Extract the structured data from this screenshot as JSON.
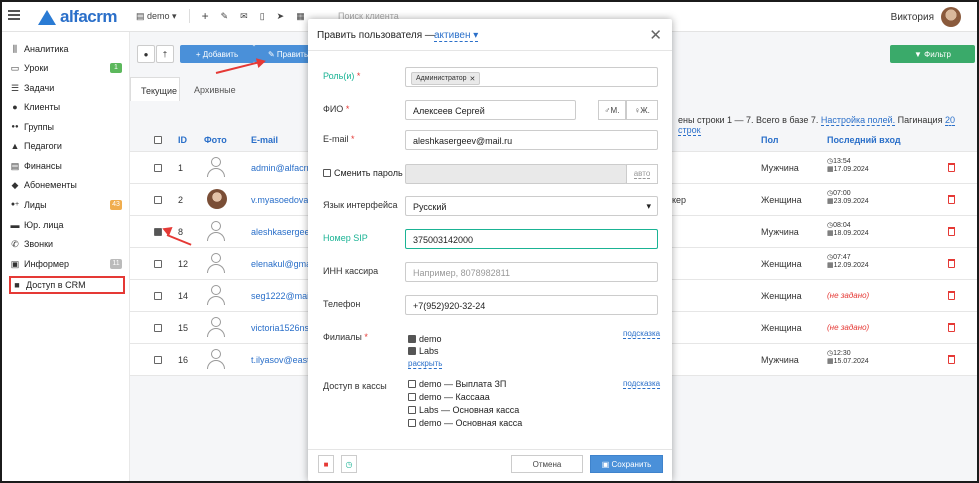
{
  "app": {
    "logo_text": "alfacrm",
    "user_name": "Виктория",
    "search_placeholder": "Поиск клиента"
  },
  "topbar": {
    "branch": "demo",
    "branch_caret": "▾",
    "plus_label": "+",
    "icons": [
      "wrench-icon",
      "mail-icon",
      "phone-icon",
      "telegram-icon",
      "calendar-icon"
    ]
  },
  "sidebar": {
    "items": [
      {
        "label": "Аналитика",
        "icon": "chart-icon",
        "glyph": "⫼"
      },
      {
        "label": "Уроки",
        "icon": "calendar-icon",
        "glyph": "▭",
        "badge": "1",
        "badge_color": "#5cb85c"
      },
      {
        "label": "Задачи",
        "icon": "tasks-icon",
        "glyph": "☰"
      },
      {
        "label": "Клиенты",
        "icon": "user-icon",
        "glyph": "●"
      },
      {
        "label": "Группы",
        "icon": "users-icon",
        "glyph": "●●"
      },
      {
        "label": "Педагоги",
        "icon": "graduation-icon",
        "glyph": "▲"
      },
      {
        "label": "Финансы",
        "icon": "money-icon",
        "glyph": "▤"
      },
      {
        "label": "Абонементы",
        "icon": "tag-icon",
        "glyph": "◆"
      },
      {
        "label": "Лиды",
        "icon": "leads-icon",
        "glyph": "●+",
        "badge": "43",
        "badge_color": "#f0ad4e"
      },
      {
        "label": "Юр. лица",
        "icon": "briefcase-icon",
        "glyph": "▬"
      },
      {
        "label": "Звонки",
        "icon": "phone-icon",
        "glyph": "✆"
      },
      {
        "label": "Информер",
        "icon": "informer-icon",
        "glyph": "▣",
        "badge": "11",
        "badge_color": "#bbbbbb"
      },
      {
        "label": "Доступ в CRM",
        "icon": "lock-icon",
        "glyph": "🔒"
      }
    ]
  },
  "toolbar": {
    "add_label": "+ Добавить",
    "edit_label": "✎ Править",
    "filter_label": "▼ Фильтр"
  },
  "tabs": {
    "current": "Текущие",
    "archive": "Архивные"
  },
  "table": {
    "info_prefix": "ены строки 1 — 7. Всего в базе 7.",
    "settings_link": "Настройка полей.",
    "pagination_label": "Пагинация",
    "pagination_link": "20 строк",
    "headers": {
      "id": "ID",
      "photo": "Фото",
      "email": "E-mail",
      "gender": "Пол",
      "last_login": "Последний вход"
    },
    "rows": [
      {
        "id": "1",
        "email": "admin@alfacrm.",
        "gender": "Мужчина",
        "time": "13:54",
        "date": "17.09.2024",
        "checked": false
      },
      {
        "id": "2",
        "email": "v.myasoedova@",
        "gender": "Женщина",
        "time": "07:00",
        "date": "23.09.2024",
        "checked": false,
        "extra": "кер",
        "photo": true
      },
      {
        "id": "8",
        "email": "aleshkasergeev",
        "gender": "Мужчина",
        "time": "08:04",
        "date": "18.09.2024",
        "checked": true
      },
      {
        "id": "12",
        "email": "elenakul@gmail",
        "gender": "Женщина",
        "time": "07:47",
        "date": "12.09.2024",
        "checked": false
      },
      {
        "id": "14",
        "email": "seg1222@mail.r",
        "gender": "Женщина",
        "unset": "(не задано)",
        "checked": false
      },
      {
        "id": "15",
        "email": "victoria1526nsk",
        "gender": "Женщина",
        "unset": "(не задано)",
        "checked": false
      },
      {
        "id": "16",
        "email": "t.ilyasov@eastin",
        "gender": "Мужчина",
        "time": "12:30",
        "date": "15.07.2024",
        "checked": false
      }
    ]
  },
  "modal": {
    "title": "Править пользователя —",
    "status": "активен",
    "role_label": "Роль(и)",
    "role_tag": "Администратор",
    "fio_label": "ФИО",
    "fio_value": "Алексеев Сергей",
    "gender_m": "М.",
    "gender_f": "Ж.",
    "email_label": "E-mail",
    "email_value": "aleshkasergeev@mail.ru",
    "change_pass_label": "Сменить пароль",
    "auto_label": "авто",
    "lang_label": "Язык интерфейса",
    "lang_value": "Русский",
    "sip_label": "Номер SIP",
    "sip_value": "375003142000",
    "inn_label": "ИНН кассира",
    "inn_placeholder": "Например, 8078982811",
    "phone_label": "Телефон",
    "phone_value": "+7(952)920-32-24",
    "branches_label": "Филиалы",
    "branches": [
      "demo",
      "Labs"
    ],
    "expand_link": "раскрыть",
    "hint_link": "подсказка",
    "cash_label": "Доступ в кассы",
    "cash_items": [
      "demo — Выплата ЗП",
      "demo — Кассааа",
      "Labs — Основная касса",
      "demo — Основная касса"
    ],
    "cancel_label": "Отмена",
    "save_label": "Сохранить"
  },
  "colors": {
    "accent": "#2a6fc9",
    "save": "#4a90d9",
    "filter": "#3aaa6a",
    "highlight": "#e53935",
    "sip_label": "#1ab394"
  }
}
